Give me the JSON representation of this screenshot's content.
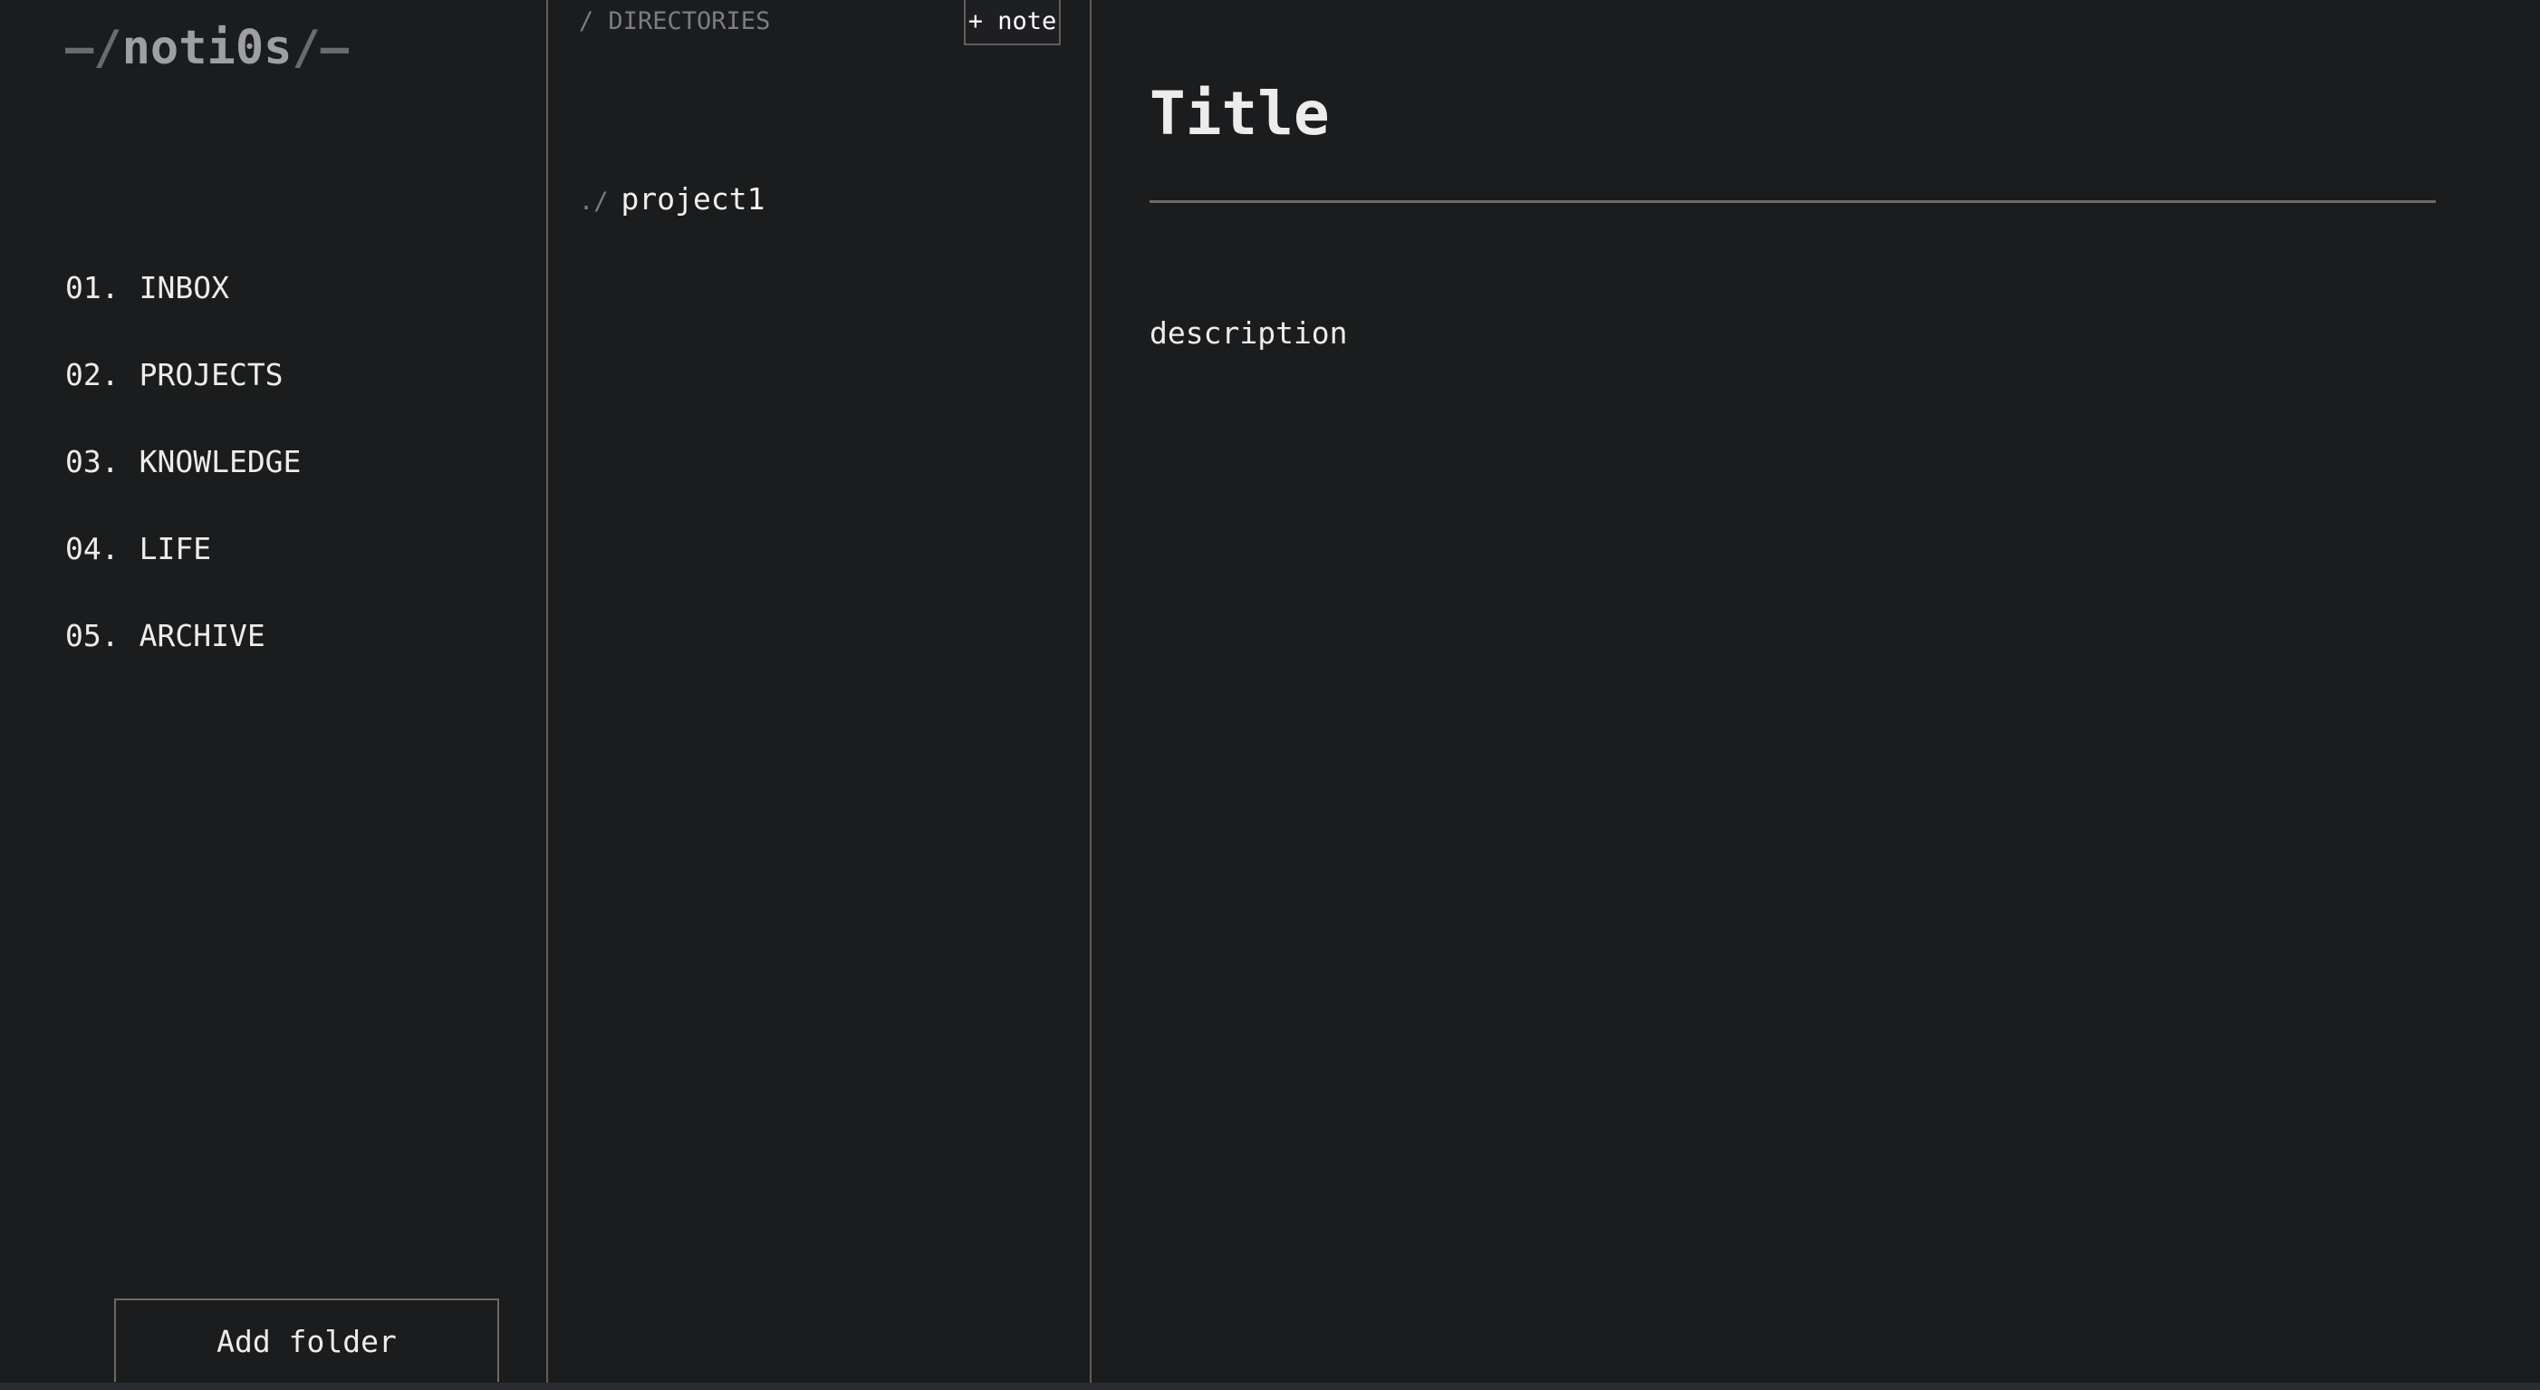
{
  "app": {
    "brand_prefix": "—/",
    "brand_name": "noti0s",
    "brand_suffix": "/—"
  },
  "sidebar": {
    "items": [
      {
        "number": "01.",
        "label": "INBOX"
      },
      {
        "number": "02.",
        "label": "PROJECTS"
      },
      {
        "number": "03.",
        "label": "KNOWLEDGE"
      },
      {
        "number": "04.",
        "label": "LIFE"
      },
      {
        "number": "05.",
        "label": "ARCHIVE"
      }
    ],
    "add_folder_label": "Add folder"
  },
  "directories": {
    "header": "/ DIRECTORIES",
    "add_note_label": "+ note",
    "items": [
      {
        "prefix": "./",
        "name": "project1"
      }
    ]
  },
  "note": {
    "title": "Title",
    "description": "description"
  },
  "colors": {
    "background": "#1b1c1e",
    "text": "#ececea",
    "muted": "#7c7d7f",
    "divider": "#5f5e5a",
    "title_rule": "#6e6a62"
  }
}
